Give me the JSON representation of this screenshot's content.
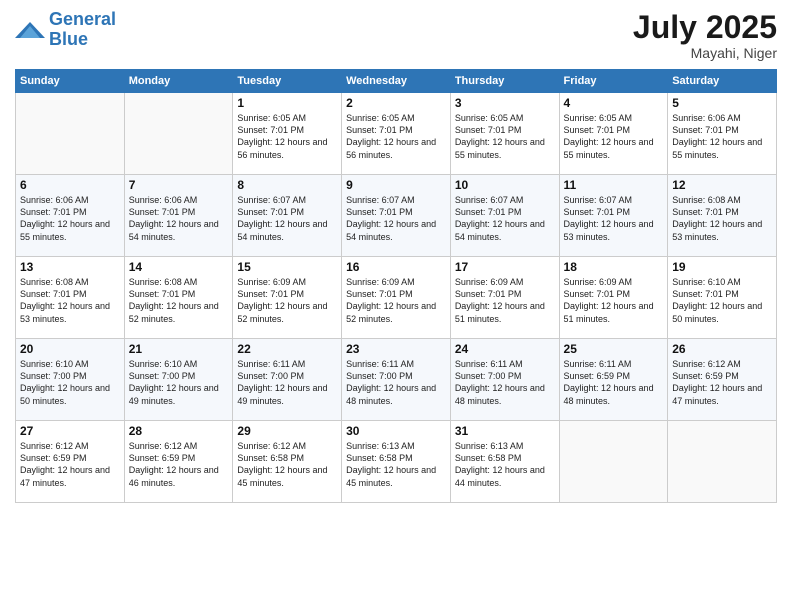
{
  "logo": {
    "line1": "General",
    "line2": "Blue"
  },
  "title": "July 2025",
  "location": "Mayahi, Niger",
  "days_header": [
    "Sunday",
    "Monday",
    "Tuesday",
    "Wednesday",
    "Thursday",
    "Friday",
    "Saturday"
  ],
  "weeks": [
    [
      {
        "day": "",
        "sunrise": "",
        "sunset": "",
        "daylight": ""
      },
      {
        "day": "",
        "sunrise": "",
        "sunset": "",
        "daylight": ""
      },
      {
        "day": "1",
        "sunrise": "Sunrise: 6:05 AM",
        "sunset": "Sunset: 7:01 PM",
        "daylight": "Daylight: 12 hours and 56 minutes."
      },
      {
        "day": "2",
        "sunrise": "Sunrise: 6:05 AM",
        "sunset": "Sunset: 7:01 PM",
        "daylight": "Daylight: 12 hours and 56 minutes."
      },
      {
        "day": "3",
        "sunrise": "Sunrise: 6:05 AM",
        "sunset": "Sunset: 7:01 PM",
        "daylight": "Daylight: 12 hours and 55 minutes."
      },
      {
        "day": "4",
        "sunrise": "Sunrise: 6:05 AM",
        "sunset": "Sunset: 7:01 PM",
        "daylight": "Daylight: 12 hours and 55 minutes."
      },
      {
        "day": "5",
        "sunrise": "Sunrise: 6:06 AM",
        "sunset": "Sunset: 7:01 PM",
        "daylight": "Daylight: 12 hours and 55 minutes."
      }
    ],
    [
      {
        "day": "6",
        "sunrise": "Sunrise: 6:06 AM",
        "sunset": "Sunset: 7:01 PM",
        "daylight": "Daylight: 12 hours and 55 minutes."
      },
      {
        "day": "7",
        "sunrise": "Sunrise: 6:06 AM",
        "sunset": "Sunset: 7:01 PM",
        "daylight": "Daylight: 12 hours and 54 minutes."
      },
      {
        "day": "8",
        "sunrise": "Sunrise: 6:07 AM",
        "sunset": "Sunset: 7:01 PM",
        "daylight": "Daylight: 12 hours and 54 minutes."
      },
      {
        "day": "9",
        "sunrise": "Sunrise: 6:07 AM",
        "sunset": "Sunset: 7:01 PM",
        "daylight": "Daylight: 12 hours and 54 minutes."
      },
      {
        "day": "10",
        "sunrise": "Sunrise: 6:07 AM",
        "sunset": "Sunset: 7:01 PM",
        "daylight": "Daylight: 12 hours and 54 minutes."
      },
      {
        "day": "11",
        "sunrise": "Sunrise: 6:07 AM",
        "sunset": "Sunset: 7:01 PM",
        "daylight": "Daylight: 12 hours and 53 minutes."
      },
      {
        "day": "12",
        "sunrise": "Sunrise: 6:08 AM",
        "sunset": "Sunset: 7:01 PM",
        "daylight": "Daylight: 12 hours and 53 minutes."
      }
    ],
    [
      {
        "day": "13",
        "sunrise": "Sunrise: 6:08 AM",
        "sunset": "Sunset: 7:01 PM",
        "daylight": "Daylight: 12 hours and 53 minutes."
      },
      {
        "day": "14",
        "sunrise": "Sunrise: 6:08 AM",
        "sunset": "Sunset: 7:01 PM",
        "daylight": "Daylight: 12 hours and 52 minutes."
      },
      {
        "day": "15",
        "sunrise": "Sunrise: 6:09 AM",
        "sunset": "Sunset: 7:01 PM",
        "daylight": "Daylight: 12 hours and 52 minutes."
      },
      {
        "day": "16",
        "sunrise": "Sunrise: 6:09 AM",
        "sunset": "Sunset: 7:01 PM",
        "daylight": "Daylight: 12 hours and 52 minutes."
      },
      {
        "day": "17",
        "sunrise": "Sunrise: 6:09 AM",
        "sunset": "Sunset: 7:01 PM",
        "daylight": "Daylight: 12 hours and 51 minutes."
      },
      {
        "day": "18",
        "sunrise": "Sunrise: 6:09 AM",
        "sunset": "Sunset: 7:01 PM",
        "daylight": "Daylight: 12 hours and 51 minutes."
      },
      {
        "day": "19",
        "sunrise": "Sunrise: 6:10 AM",
        "sunset": "Sunset: 7:01 PM",
        "daylight": "Daylight: 12 hours and 50 minutes."
      }
    ],
    [
      {
        "day": "20",
        "sunrise": "Sunrise: 6:10 AM",
        "sunset": "Sunset: 7:00 PM",
        "daylight": "Daylight: 12 hours and 50 minutes."
      },
      {
        "day": "21",
        "sunrise": "Sunrise: 6:10 AM",
        "sunset": "Sunset: 7:00 PM",
        "daylight": "Daylight: 12 hours and 49 minutes."
      },
      {
        "day": "22",
        "sunrise": "Sunrise: 6:11 AM",
        "sunset": "Sunset: 7:00 PM",
        "daylight": "Daylight: 12 hours and 49 minutes."
      },
      {
        "day": "23",
        "sunrise": "Sunrise: 6:11 AM",
        "sunset": "Sunset: 7:00 PM",
        "daylight": "Daylight: 12 hours and 48 minutes."
      },
      {
        "day": "24",
        "sunrise": "Sunrise: 6:11 AM",
        "sunset": "Sunset: 7:00 PM",
        "daylight": "Daylight: 12 hours and 48 minutes."
      },
      {
        "day": "25",
        "sunrise": "Sunrise: 6:11 AM",
        "sunset": "Sunset: 6:59 PM",
        "daylight": "Daylight: 12 hours and 48 minutes."
      },
      {
        "day": "26",
        "sunrise": "Sunrise: 6:12 AM",
        "sunset": "Sunset: 6:59 PM",
        "daylight": "Daylight: 12 hours and 47 minutes."
      }
    ],
    [
      {
        "day": "27",
        "sunrise": "Sunrise: 6:12 AM",
        "sunset": "Sunset: 6:59 PM",
        "daylight": "Daylight: 12 hours and 47 minutes."
      },
      {
        "day": "28",
        "sunrise": "Sunrise: 6:12 AM",
        "sunset": "Sunset: 6:59 PM",
        "daylight": "Daylight: 12 hours and 46 minutes."
      },
      {
        "day": "29",
        "sunrise": "Sunrise: 6:12 AM",
        "sunset": "Sunset: 6:58 PM",
        "daylight": "Daylight: 12 hours and 45 minutes."
      },
      {
        "day": "30",
        "sunrise": "Sunrise: 6:13 AM",
        "sunset": "Sunset: 6:58 PM",
        "daylight": "Daylight: 12 hours and 45 minutes."
      },
      {
        "day": "31",
        "sunrise": "Sunrise: 6:13 AM",
        "sunset": "Sunset: 6:58 PM",
        "daylight": "Daylight: 12 hours and 44 minutes."
      },
      {
        "day": "",
        "sunrise": "",
        "sunset": "",
        "daylight": ""
      },
      {
        "day": "",
        "sunrise": "",
        "sunset": "",
        "daylight": ""
      }
    ]
  ]
}
